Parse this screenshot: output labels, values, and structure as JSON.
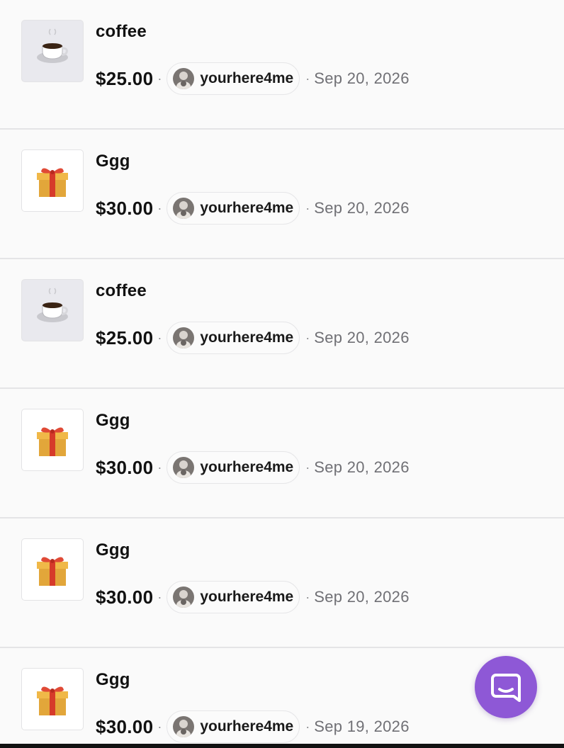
{
  "transactions": [
    {
      "icon": "coffee-cup-icon",
      "name": "coffee",
      "amount": "$25.00",
      "user": "yourhere4me",
      "date": "Sep 20, 2026"
    },
    {
      "icon": "gift-box-icon",
      "name": "Ggg",
      "amount": "$30.00",
      "user": "yourhere4me",
      "date": "Sep 20, 2026"
    },
    {
      "icon": "coffee-cup-icon",
      "name": "coffee",
      "amount": "$25.00",
      "user": "yourhere4me",
      "date": "Sep 20, 2026"
    },
    {
      "icon": "gift-box-icon",
      "name": "Ggg",
      "amount": "$30.00",
      "user": "yourhere4me",
      "date": "Sep 20, 2026"
    },
    {
      "icon": "gift-box-icon",
      "name": "Ggg",
      "amount": "$30.00",
      "user": "yourhere4me",
      "date": "Sep 20, 2026"
    },
    {
      "icon": "gift-box-icon",
      "name": "Ggg",
      "amount": "$30.00",
      "user": "yourhere4me",
      "date": "Sep 19, 2026"
    }
  ],
  "separator": "·",
  "chat_button": {
    "icon": "chat-bubble-icon"
  },
  "colors": {
    "accent": "#8e58d6",
    "date_text": "#707075",
    "divider": "#e4e4e6"
  }
}
